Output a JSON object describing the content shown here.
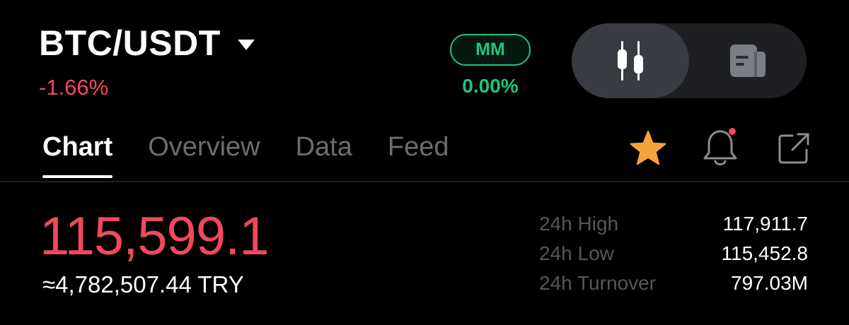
{
  "header": {
    "pair": "BTC/USDT",
    "change": "-1.66%",
    "mm_label": "MM",
    "mm_value": "0.00%"
  },
  "view_toggle": {
    "options": [
      "candlestick-chart-icon",
      "document-icon"
    ],
    "active": "candlestick-chart-icon"
  },
  "tabs": [
    {
      "label": "Chart",
      "active": true
    },
    {
      "label": "Overview",
      "active": false
    },
    {
      "label": "Data",
      "active": false
    },
    {
      "label": "Feed",
      "active": false
    }
  ],
  "tab_actions": {
    "favorite_icon": "star-icon",
    "alert_icon": "bell-icon",
    "share_icon": "external-link-icon",
    "alert_dot": true
  },
  "price": {
    "last": "115,599.1",
    "converted": "≈4,782,507.44 TRY"
  },
  "stats": [
    {
      "label": "24h High",
      "value": "117,911.7"
    },
    {
      "label": "24h Low",
      "value": "115,452.8"
    },
    {
      "label": "24h Turnover",
      "value": "797.03M"
    }
  ],
  "colors": {
    "down": "#f0485d",
    "up": "#1fc47a",
    "star": "#f7a33b",
    "alert_dot": "#f0485d",
    "muted_text": "#6b6d72"
  }
}
